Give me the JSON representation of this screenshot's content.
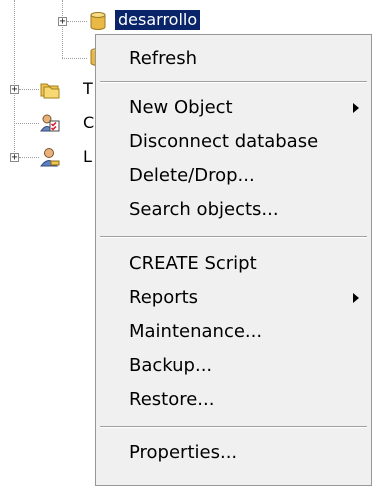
{
  "tree": {
    "selected_node_label": "desarrollo",
    "partial_labels": [
      "T",
      "C",
      "L"
    ],
    "expander_symbol": "+"
  },
  "menu": {
    "refresh": "Refresh",
    "new_object": "New Object",
    "disconnect_database": "Disconnect database",
    "delete_drop": "Delete/Drop...",
    "search_objects": "Search objects...",
    "create_script": "CREATE Script",
    "reports": "Reports",
    "maintenance": "Maintenance...",
    "backup": "Backup...",
    "restore": "Restore...",
    "properties": "Properties..."
  },
  "colors": {
    "selection_bg": "#0a246a",
    "menu_bg": "#f0f0f0"
  }
}
